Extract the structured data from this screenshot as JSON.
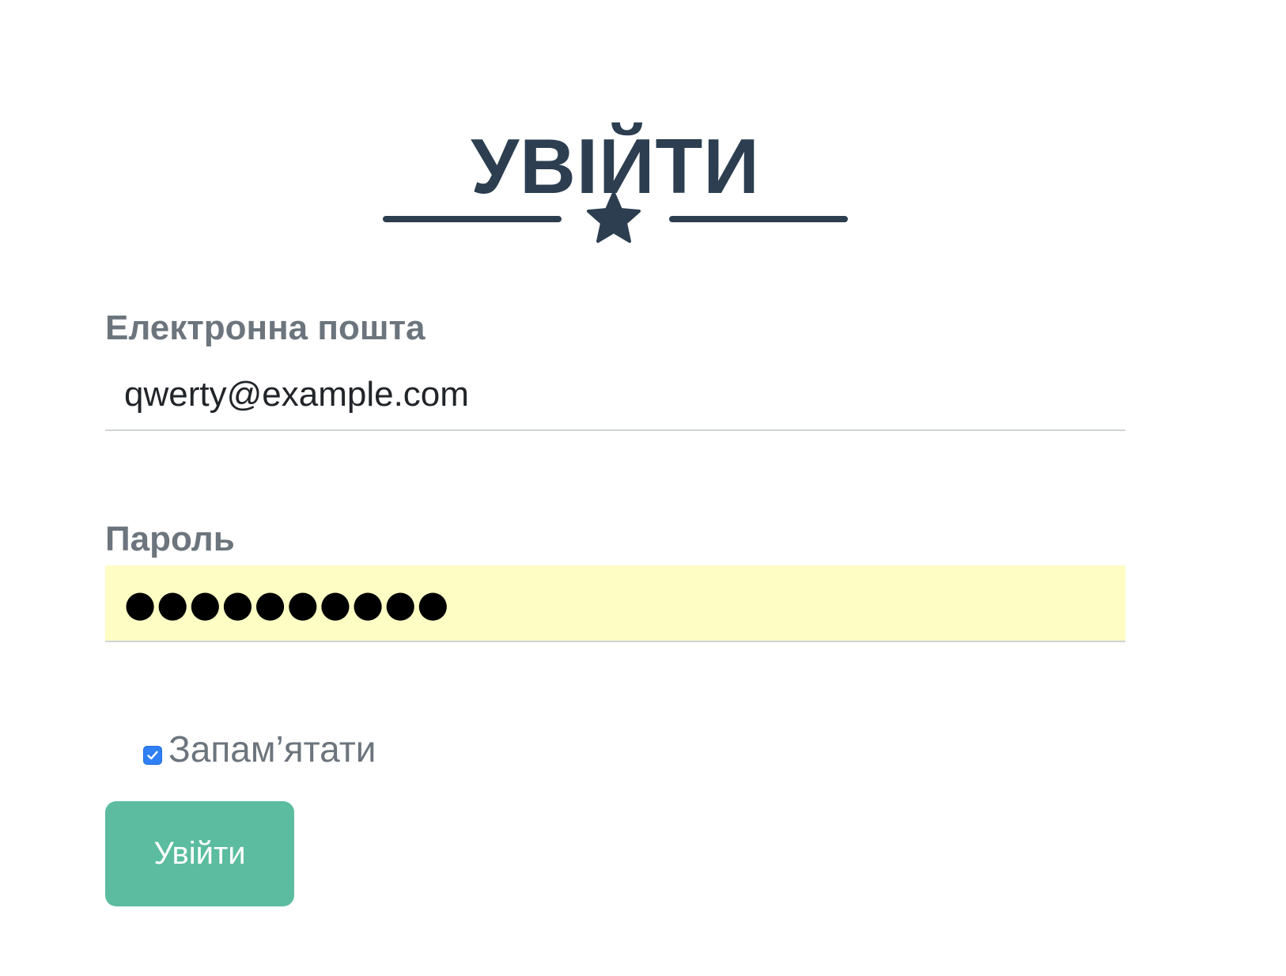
{
  "header": {
    "title": "УВІЙТИ"
  },
  "icons": {
    "divider": "star-icon",
    "checkbox": "check-icon"
  },
  "form": {
    "email": {
      "label": "Електронна пошта",
      "value": "qwerty@example.com"
    },
    "password": {
      "label": "Пароль",
      "masked_value": "●●●●●●●●●●"
    },
    "remember": {
      "label": "Запам’ятати",
      "checked": true
    },
    "submit_label": "Увійти"
  },
  "colors": {
    "heading": "#2c3e50",
    "label": "#6c757d",
    "autofill_background": "#fdfdc4",
    "checkbox": "#2f7ff5",
    "submit_button": "#5bbc9f"
  }
}
